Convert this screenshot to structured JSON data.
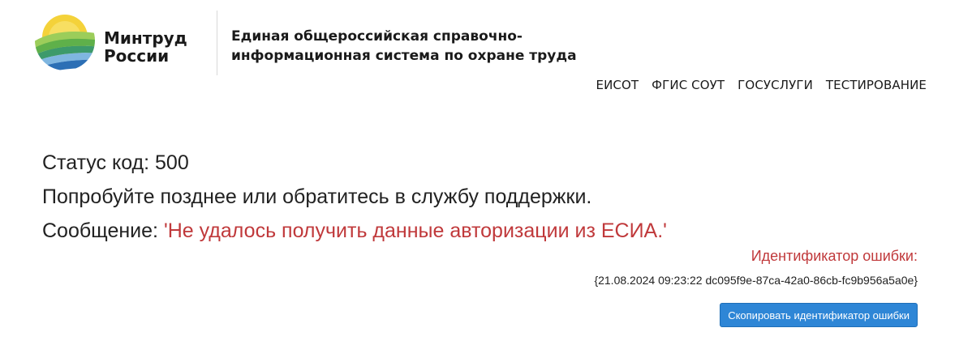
{
  "header": {
    "logo": {
      "line1": "Минтруд",
      "line2": "России",
      "icon": "mintrud-logo-icon",
      "colors": {
        "sun": "#f4d23a",
        "green": "#5fb04a",
        "blue": "#2c6fb5",
        "light_blue": "#7fb6e0"
      }
    },
    "system_title": {
      "line1": "Единая общероссийская справочно-",
      "line2": "информационная система по охране труда"
    },
    "nav": [
      {
        "label": "ЕИСОТ"
      },
      {
        "label": "ФГИС СОУТ"
      },
      {
        "label": "ГОСУСЛУГИ"
      },
      {
        "label": "ТЕСТИРОВАНИЕ"
      }
    ]
  },
  "error": {
    "status_label": "Статус код: 500",
    "advice": "Попробуйте позднее или обратитесь в службу поддержки.",
    "message_label": "Сообщение: ",
    "message_text": "'Не удалось получить данные авторизации из ЕСИА.'",
    "id_label": "Идентификатор ошибки:",
    "id_value": "{21.08.2024 09:23:22 dc095f9e-87ca-42a0-86cb-fc9b956a5a0e}",
    "copy_button_label": "Скопировать идентификатор ошибки",
    "accent_color": "#c0393b",
    "button_color": "#2e86d6"
  }
}
